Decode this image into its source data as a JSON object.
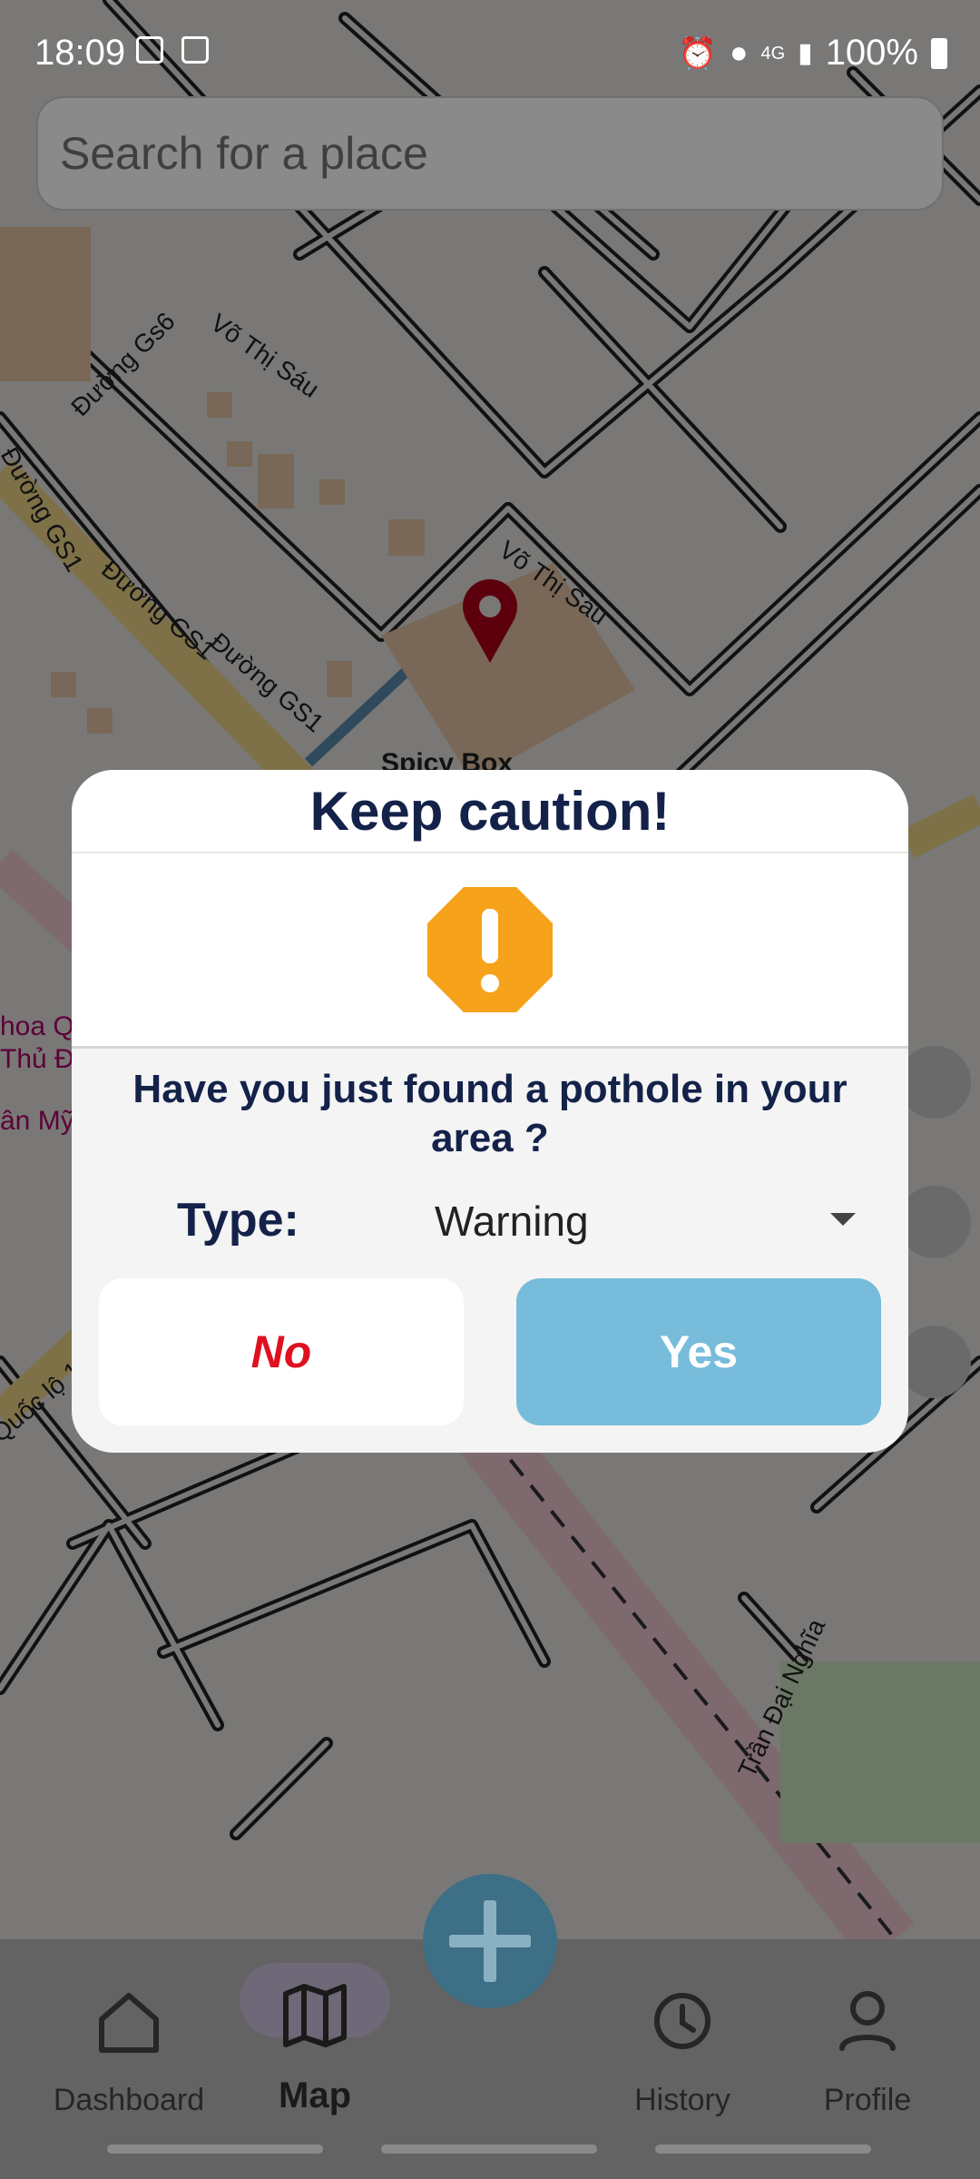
{
  "status_bar": {
    "time": "18:09",
    "network": "4G",
    "battery": "100%"
  },
  "search": {
    "placeholder": "Search for a place"
  },
  "map": {
    "labels": [
      "Võ Thị Sáu",
      "Võ Thị Sáu",
      "Đường Gs6",
      "Đường GS1",
      "Đường GS1",
      "Đường GS1",
      "Spicy Box",
      "Trần Đại Nghĩa",
      "Quốc lộ 1",
      "hoa Q",
      "Thủ Đứ",
      "ân Mỹ"
    ]
  },
  "dialog": {
    "title": "Keep caution!",
    "icon": "warning-octagon-icon",
    "question": "Have you just found a pothole in your area ?",
    "type_label": "Type:",
    "type_value": "Warning",
    "no_label": "No",
    "yes_label": "Yes",
    "colors": {
      "title": "#14224a",
      "no_text": "#e01020",
      "yes_bg": "#77bcdb",
      "warning": "#f7a21b"
    }
  },
  "nav": {
    "items": [
      {
        "label": "Dashboard",
        "icon": "home-icon"
      },
      {
        "label": "Map",
        "icon": "map-icon"
      },
      {
        "label": "History",
        "icon": "history-icon"
      },
      {
        "label": "Profile",
        "icon": "profile-icon"
      }
    ],
    "fab_icon": "plus-icon"
  }
}
